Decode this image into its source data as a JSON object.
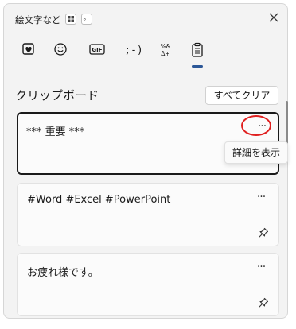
{
  "header": {
    "title": "絵文字など",
    "dot_button": "。"
  },
  "tabs": [
    {
      "name": "kaomoji-favorites",
      "icon": "heart-square-icon",
      "active": false
    },
    {
      "name": "emoji",
      "icon": "smiley-icon",
      "active": false
    },
    {
      "name": "gif",
      "icon": "gif-icon",
      "label": "GIF",
      "active": false
    },
    {
      "name": "kaomoji",
      "icon": "kaomoji-icon",
      "label": ";-)",
      "active": false
    },
    {
      "name": "symbols",
      "icon": "symbols-icon",
      "label": "%&\nΔ+",
      "active": false
    },
    {
      "name": "clipboard",
      "icon": "clipboard-icon",
      "active": true
    }
  ],
  "clipboard": {
    "title": "クリップボード",
    "clear_all": "すべてクリア",
    "items": [
      {
        "text": "*** 重要 ***",
        "selected": true
      },
      {
        "text": "#Word #Excel #PowerPoint",
        "selected": false
      },
      {
        "text": "お疲れ様です。",
        "selected": false
      }
    ]
  },
  "tooltip": "詳細を表示",
  "more_label": "···",
  "colors": {
    "accent": "#2b5797",
    "highlight_ring": "#e02020",
    "panel_bg": "#f3f3f3",
    "card_bg": "#fbfbfb"
  }
}
